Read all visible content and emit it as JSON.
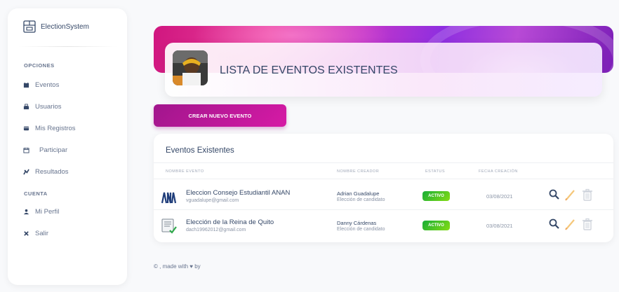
{
  "brand": {
    "name": "ElectionSystem"
  },
  "sidebar": {
    "section_options": "OPCIONES",
    "section_account": "CUENTA",
    "items": [
      {
        "label": "Eventos",
        "icon": "calendar-icon"
      },
      {
        "label": "Usuarios",
        "icon": "users-icon"
      },
      {
        "label": "Mis Registros",
        "icon": "registry-icon"
      },
      {
        "label": "Participar",
        "icon": "calendar-check-icon"
      },
      {
        "label": "Resultados",
        "icon": "chart-icon"
      },
      {
        "label": "Mi Perfil",
        "icon": "profile-icon"
      },
      {
        "label": "Salir",
        "icon": "logout-icon"
      }
    ]
  },
  "header": {
    "title": "LISTA DE EVENTOS EXISTENTES"
  },
  "actions": {
    "create_label": "CREAR NUEVO EVENTO"
  },
  "table": {
    "title": "Eventos Existentes",
    "headers": [
      "NOMBRE EVENTO",
      "NOMBRE CREADOR",
      "ESTATUS",
      "FECHA CREACIÓN"
    ],
    "rows": [
      {
        "event": "Eleccion Consejo Estudiantil ANAN",
        "email": "vguadalupe@gmail.com",
        "creator": "Adrian Guadalupe",
        "creator_sub": "Elección de candidato",
        "status": "ACTIVO",
        "date": "03/08/2021"
      },
      {
        "event": "Elección de la Reina de Quito",
        "email": "dach19962012@gmail.com",
        "creator": "Danny Cárdenas",
        "creator_sub": "Elección de candidato",
        "status": "ACTIVO",
        "date": "03/08/2021"
      }
    ]
  },
  "footer": {
    "text": "© , made with ♥ by"
  },
  "colors": {
    "accent": "#cb0c9f",
    "status_active": "#17ad37",
    "text": "#344767",
    "muted": "#67748e"
  }
}
